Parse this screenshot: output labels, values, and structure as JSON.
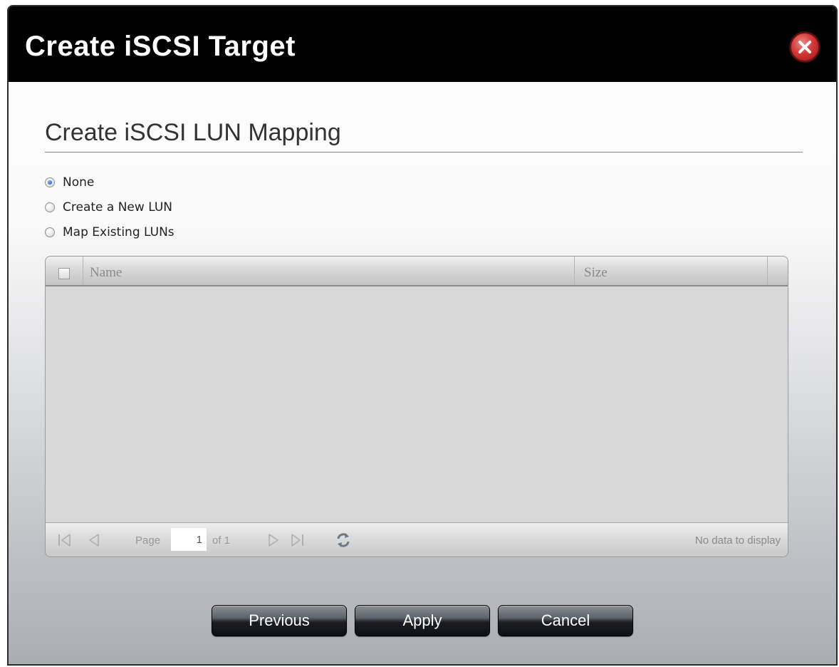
{
  "dialog": {
    "title": "Create iSCSI Target",
    "close_icon": "close-icon"
  },
  "section": {
    "title": "Create iSCSI LUN Mapping"
  },
  "options": [
    {
      "label": "None",
      "checked": true
    },
    {
      "label": "Create a New LUN",
      "checked": false
    },
    {
      "label": "Map Existing LUNs",
      "checked": false
    }
  ],
  "grid": {
    "columns": [
      "Name",
      "Size"
    ],
    "rows": [],
    "pager": {
      "page_label": "Page",
      "page_value": "1",
      "of_label": "of 1",
      "status": "No data to display"
    }
  },
  "buttons": {
    "previous": "Previous",
    "apply": "Apply",
    "cancel": "Cancel"
  }
}
